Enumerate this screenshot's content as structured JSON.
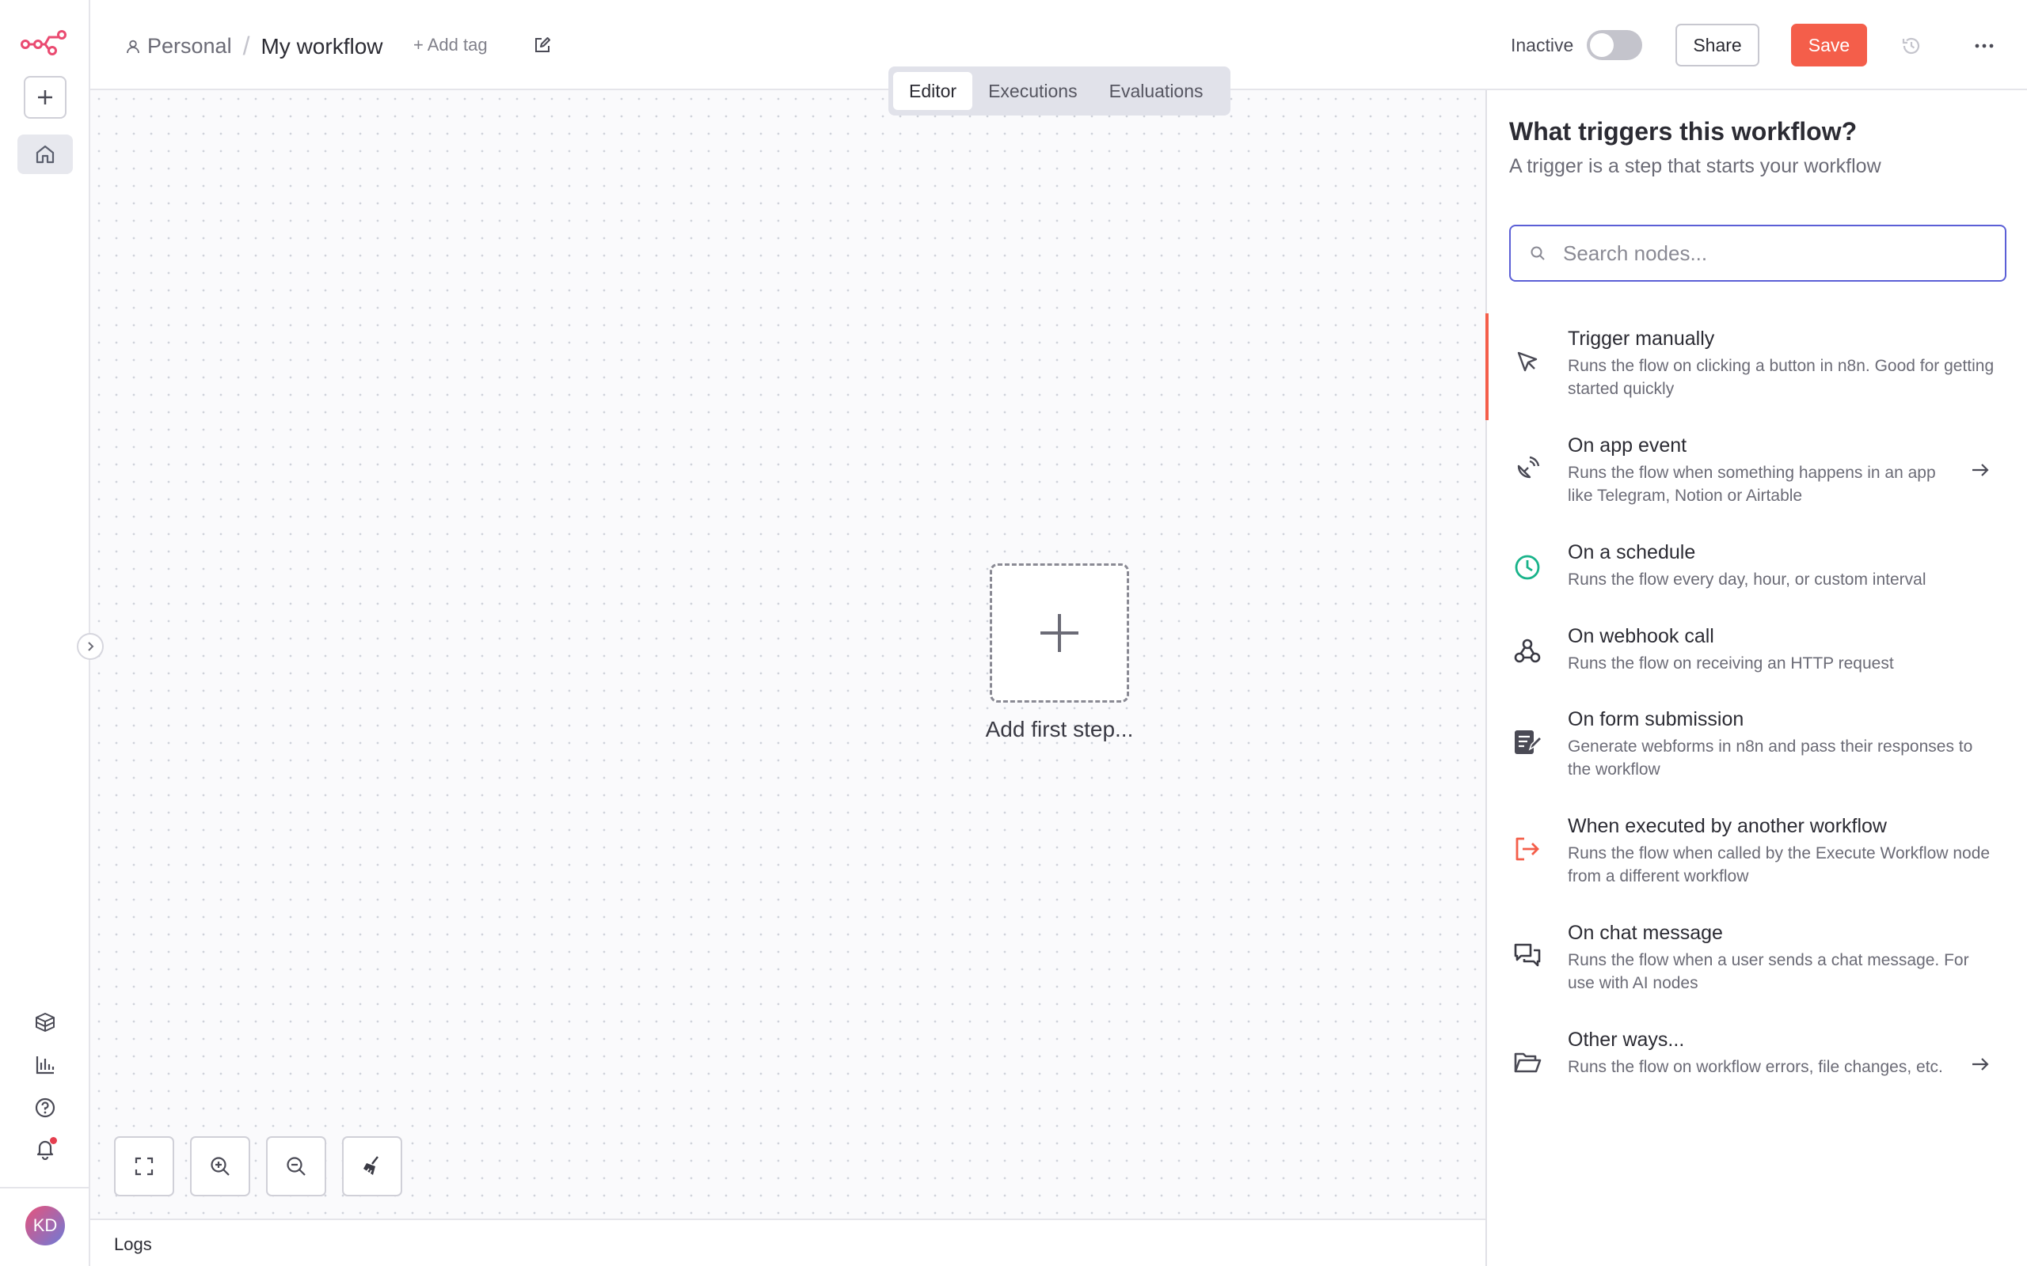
{
  "header": {
    "project": "Personal",
    "separator": "/",
    "workflow_name": "My workflow",
    "add_tag": "+ Add tag",
    "status_label": "Inactive",
    "share_label": "Share",
    "save_label": "Save",
    "more_label": "···"
  },
  "tabs": [
    {
      "label": "Editor",
      "active": true
    },
    {
      "label": "Executions",
      "active": false
    },
    {
      "label": "Evaluations",
      "active": false
    }
  ],
  "canvas": {
    "add_first_step": "Add first step..."
  },
  "logs": {
    "label": "Logs"
  },
  "user": {
    "initials": "KD"
  },
  "panel": {
    "title": "What triggers this workflow?",
    "subtitle": "A trigger is a step that starts your workflow",
    "search_placeholder": "Search nodes...",
    "items": [
      {
        "title": "Trigger manually",
        "desc": "Runs the flow on clicking a button in n8n. Good for getting started quickly",
        "icon": "cursor-icon",
        "has_arrow": false
      },
      {
        "title": "On app event",
        "desc": "Runs the flow when something happens in an app like Telegram, Notion or Airtable",
        "icon": "satellite-dish-icon",
        "has_arrow": true
      },
      {
        "title": "On a schedule",
        "desc": "Runs the flow every day, hour, or custom interval",
        "icon": "clock-icon",
        "has_arrow": false
      },
      {
        "title": "On webhook call",
        "desc": "Runs the flow on receiving an HTTP request",
        "icon": "webhook-icon",
        "has_arrow": false
      },
      {
        "title": "On form submission",
        "desc": "Generate webforms in n8n and pass their responses to the workflow",
        "icon": "form-icon",
        "has_arrow": false
      },
      {
        "title": "When executed by another workflow",
        "desc": "Runs the flow when called by the Execute Workflow node from a different workflow",
        "icon": "sign-in-icon",
        "has_arrow": false
      },
      {
        "title": "On chat message",
        "desc": "Runs the flow when a user sends a chat message. For use with AI nodes",
        "icon": "chat-icon",
        "has_arrow": false
      },
      {
        "title": "Other ways...",
        "desc": "Runs the flow on workflow errors, file changes, etc.",
        "icon": "folder-open-icon",
        "has_arrow": true
      }
    ]
  },
  "colors": {
    "accent": "#f45e4a",
    "brand": "#ea4b71",
    "focus": "#5b5fd6",
    "schedule_green": "#18b38a"
  }
}
